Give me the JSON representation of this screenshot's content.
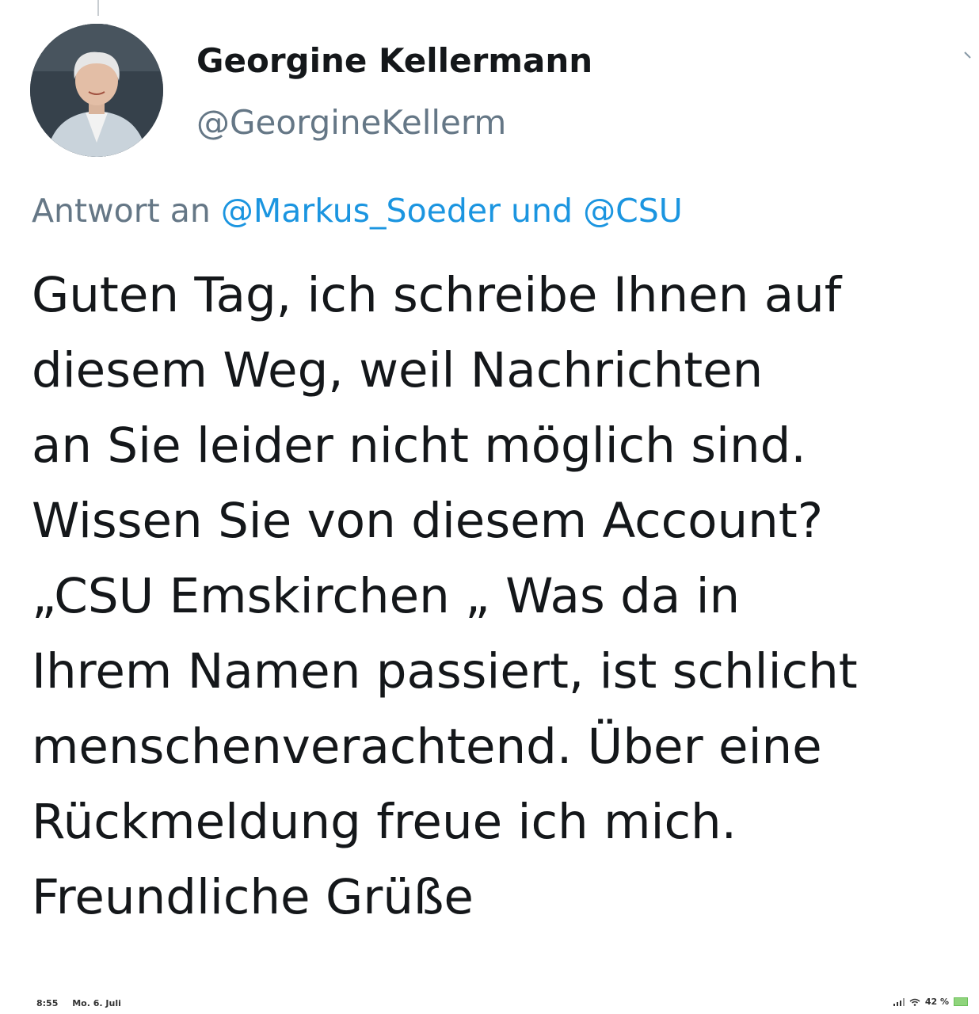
{
  "author": {
    "display_name": "Georgine Kellermann",
    "handle": "@GeorgineKellerm"
  },
  "reply": {
    "prefix": "Antwort an",
    "mention_1": "@Markus_Soeder",
    "conjunction": "und",
    "mention_2": "@CSU"
  },
  "tweet": {
    "lines": [
      "Guten Tag, ich schreibe Ihnen auf",
      "diesem Weg, weil Nachrichten",
      "an Sie leider nicht möglich sind.",
      "Wissen Sie von diesem Account?",
      "„CSU Emskirchen „ Was da in",
      "Ihrem Namen passiert, ist schlicht",
      "menschenverachtend. Über eine",
      "Rückmeldung freue ich mich.",
      "Freundliche Grüße"
    ]
  },
  "status_bar": {
    "time": "8:55",
    "date": "Mo. 6. Juli",
    "battery": "42 %"
  },
  "icons": {
    "avatar": "avatar-photo",
    "menu": "chevron-down-icon",
    "signal": "signal-icon",
    "wifi": "wifi-icon",
    "battery": "battery-icon"
  },
  "colors": {
    "text": "#14171a",
    "secondary": "#657786",
    "link": "#1b95e0"
  }
}
